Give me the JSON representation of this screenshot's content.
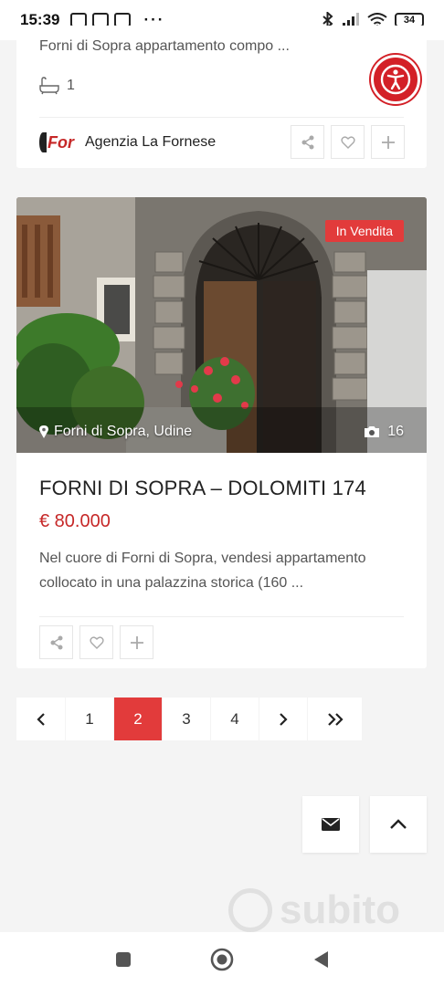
{
  "status_bar": {
    "time": "15:39",
    "battery": "34"
  },
  "listing_prev": {
    "description": "Forni di Sopra appartamento compo ...",
    "bathrooms": "1",
    "agency_name": "Agenzia La Fornese",
    "agency_logo_text": "For"
  },
  "listing": {
    "badge": "In Vendita",
    "location": "Forni di Sopra, Udine",
    "photo_count": "16",
    "title": "FORNI DI SOPRA – DOLOMITI 174",
    "price": "€ 80.000",
    "description": "Nel cuore di Forni di Sopra, vendesi appartamento collocato in una palazzina storica (160 ..."
  },
  "pagination": {
    "prev": "‹",
    "pages": [
      "1",
      "2",
      "3",
      "4"
    ],
    "active_page": "2",
    "next": "›",
    "last": "»"
  },
  "watermark": "subito",
  "colors": {
    "accent": "#e23b3b",
    "price": "#c62828",
    "a11y": "#d32027"
  }
}
